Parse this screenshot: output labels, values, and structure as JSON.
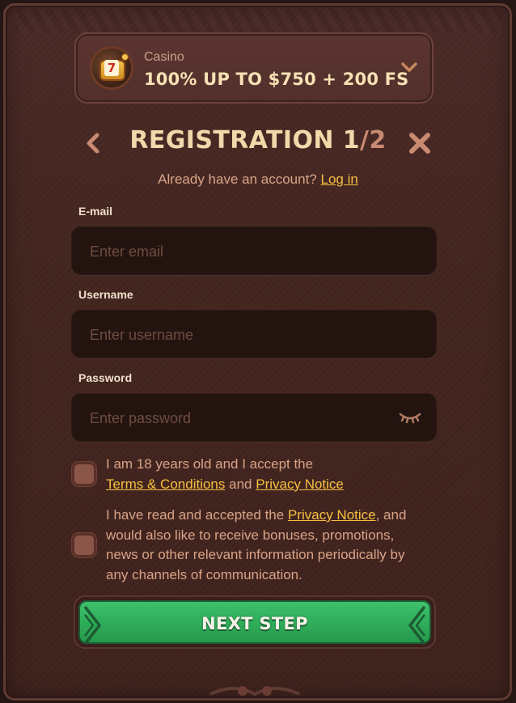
{
  "bonus": {
    "category": "Casino",
    "title": "100% UP TO $750 + 200 FS",
    "icon": "slot-machine-icon"
  },
  "header": {
    "title": "REGISTRATION 1",
    "step": "/2"
  },
  "login": {
    "prompt": "Already have an account?",
    "link": "Log in"
  },
  "form": {
    "email": {
      "label": "E-mail",
      "placeholder": "Enter email",
      "value": ""
    },
    "username": {
      "label": "Username",
      "placeholder": "Enter username",
      "value": ""
    },
    "password": {
      "label": "Password",
      "placeholder": "Enter password",
      "value": ""
    }
  },
  "checks": {
    "age": {
      "text": "I am 18 years old and I accept the",
      "terms": "Terms & Conditions",
      "and": "and",
      "privacy": "Privacy Notice"
    },
    "marketing": {
      "pre": "I have read and accepted the",
      "privacy": "Privacy Notice",
      "post": ", and would also like to receive bonuses, promotions, news or other relevant information periodically by any channels of communication."
    }
  },
  "actions": {
    "next": "NEXT STEP"
  },
  "colors": {
    "accent": "#f6c042",
    "title": "#f2d8aa",
    "button": "#2fae5a",
    "panel": "#43251f"
  }
}
